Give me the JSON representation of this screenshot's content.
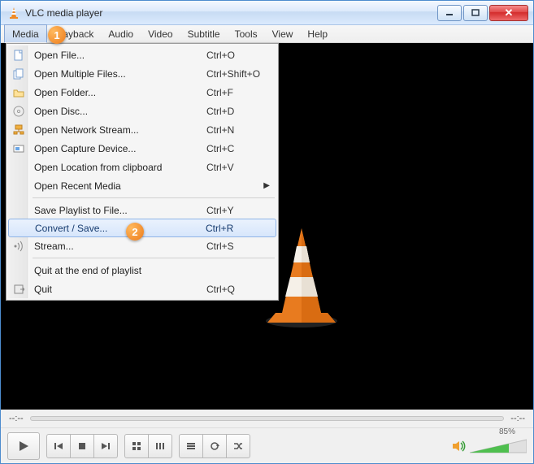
{
  "window": {
    "title": "VLC media player"
  },
  "menubar": {
    "items": [
      "Media",
      "Playback",
      "Audio",
      "Video",
      "Subtitle",
      "Tools",
      "View",
      "Help"
    ],
    "active_index": 0
  },
  "annotations": {
    "badge1": "1",
    "badge2": "2"
  },
  "dropdown": {
    "groups": [
      [
        {
          "icon": "file-icon",
          "label": "Open File...",
          "shortcut": "Ctrl+O"
        },
        {
          "icon": "files-icon",
          "label": "Open Multiple Files...",
          "shortcut": "Ctrl+Shift+O"
        },
        {
          "icon": "folder-icon",
          "label": "Open Folder...",
          "shortcut": "Ctrl+F"
        },
        {
          "icon": "disc-icon",
          "label": "Open Disc...",
          "shortcut": "Ctrl+D"
        },
        {
          "icon": "network-icon",
          "label": "Open Network Stream...",
          "shortcut": "Ctrl+N"
        },
        {
          "icon": "capture-icon",
          "label": "Open Capture Device...",
          "shortcut": "Ctrl+C"
        },
        {
          "icon": "",
          "label": "Open Location from clipboard",
          "shortcut": "Ctrl+V"
        },
        {
          "icon": "",
          "label": "Open Recent Media",
          "shortcut": "",
          "submenu": true
        }
      ],
      [
        {
          "icon": "",
          "label": "Save Playlist to File...",
          "shortcut": "Ctrl+Y"
        },
        {
          "icon": "",
          "label": "Convert / Save...",
          "shortcut": "Ctrl+R",
          "highlight": true
        },
        {
          "icon": "stream-icon",
          "label": "Stream...",
          "shortcut": "Ctrl+S"
        }
      ],
      [
        {
          "icon": "",
          "label": "Quit at the end of playlist",
          "shortcut": ""
        },
        {
          "icon": "quit-icon",
          "label": "Quit",
          "shortcut": "Ctrl+Q"
        }
      ]
    ]
  },
  "seek": {
    "current": "--:--",
    "total": "--:--"
  },
  "volume": {
    "percent_label": "85%",
    "percent": 85
  },
  "colors": {
    "accent": "#ec7b1b",
    "highlight_border": "#8fb4e6"
  }
}
